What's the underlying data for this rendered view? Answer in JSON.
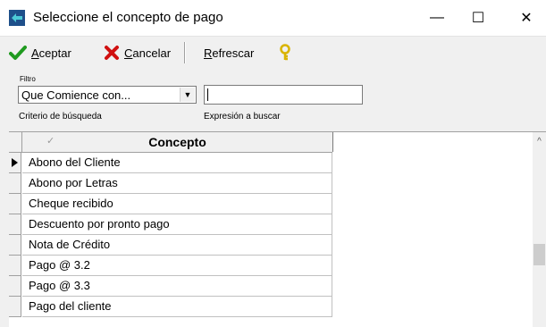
{
  "window": {
    "title": "Seleccione el concepto de pago",
    "controls": {
      "minimize": "—",
      "maximize": "☐",
      "close": "✕"
    }
  },
  "toolbar": {
    "accept_label": "Aceptar",
    "cancel_label": "Cancelar",
    "refresh_label": "Refrescar",
    "accept_icon": "checkmark-icon",
    "cancel_icon": "x-mark-icon",
    "help_icon": "key-icon"
  },
  "filter": {
    "legend": "Filtro",
    "criteria_value": "Que Comience con...",
    "criteria_label": "Criterio de búsqueda",
    "expression_value": "",
    "expression_label": "Expresión a buscar"
  },
  "grid": {
    "column_header": "Concepto",
    "selected_row": 0,
    "rows": [
      "Abono del Cliente",
      "Abono por Letras",
      "Cheque recibido",
      "Descuento por pronto pago",
      "Nota de Crédito",
      "Pago @ 3.2",
      "Pago @ 3.3",
      "Pago del cliente"
    ]
  },
  "colors": {
    "accept_green": "#1f9a1f",
    "cancel_red": "#d01010",
    "help_yellow": "#d9b400"
  }
}
